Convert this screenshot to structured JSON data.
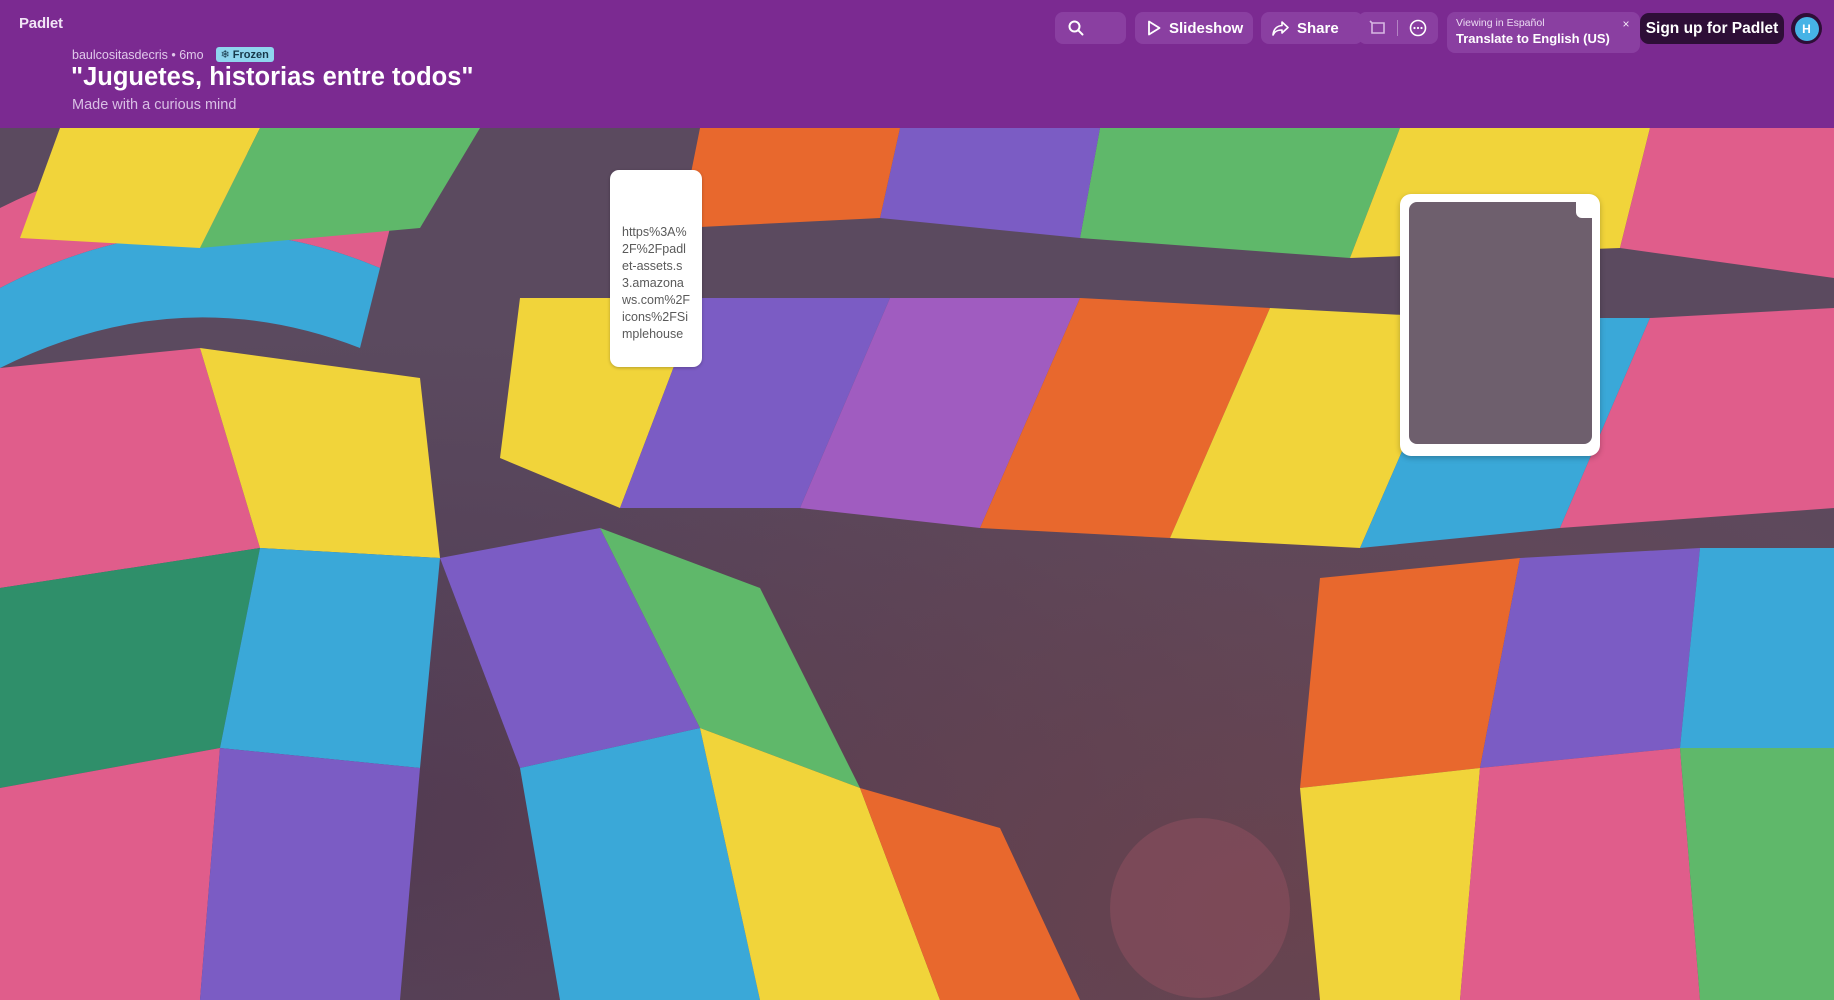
{
  "app": {
    "logo": "Padlet"
  },
  "board": {
    "author": "baulcositasdecris",
    "age": "6mo",
    "meta_text": "baulcositasdecris • 6mo",
    "status_badge": "Frozen",
    "title": "\"Juguetes, historias entre todos\"",
    "subtitle": "Made with a curious mind"
  },
  "toolbar": {
    "search_icon": "search-icon",
    "slideshow_label": "Slideshow",
    "share_label": "Share",
    "translate": {
      "viewing": "Viewing in Español",
      "action": "Translate to English (US)",
      "close": "×"
    },
    "signup_label": "Sign up for Padlet",
    "avatar_initial": "H"
  },
  "posts": {
    "link_card_text": "https%3A%2F%2Fpadlet-assets.s3.amazonaws.com%2Ficons%2FSimplehouse"
  },
  "colors": {
    "header_bg": "#7b2a91",
    "signup_bg": "#2e0e37",
    "badge_bg": "#8fd5ee"
  }
}
